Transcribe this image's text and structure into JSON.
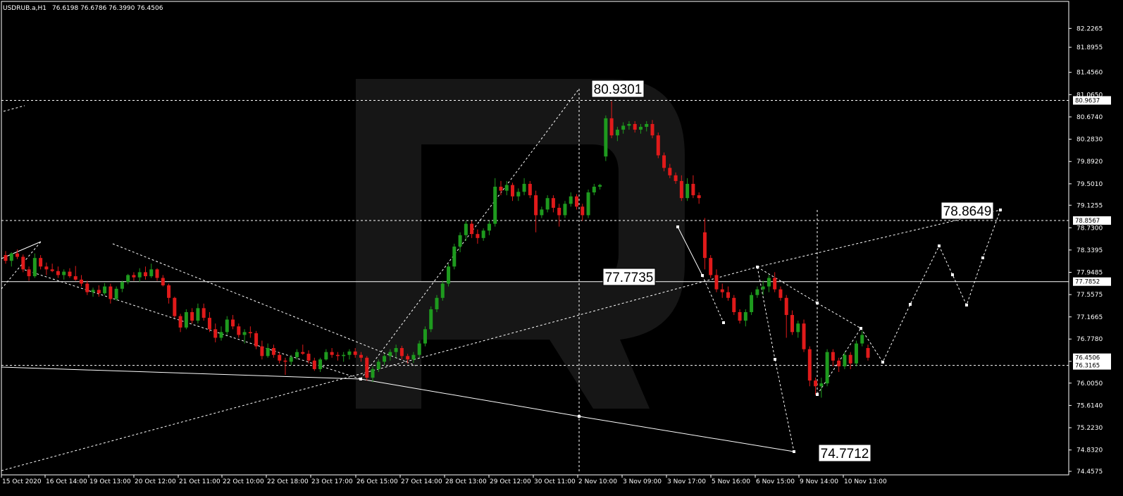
{
  "header": {
    "symbol": "USDRUB.a,H1",
    "ohlc": "76.6198 76.6786 76.3990 76.4506"
  },
  "chart_data": {
    "type": "candlestick",
    "ylim": [
      74.4575,
      82.4775
    ],
    "y_ticks": [
      "82.2265",
      "81.8955",
      "81.4560",
      "81.0650",
      "80.6740",
      "80.2830",
      "79.8920",
      "79.5010",
      "79.1255",
      "78.7300",
      "78.3395",
      "77.9485",
      "77.5575",
      "77.1665",
      "76.7780",
      "76.3870",
      "76.0050",
      "75.6140",
      "75.2230",
      "74.8320",
      "74.4575"
    ],
    "x_ticks": [
      "15 Oct 2020",
      "16 Oct 14:00",
      "19 Oct 13:00",
      "20 Oct 12:00",
      "21 Oct 11:00",
      "22 Oct 10:00",
      "22 Oct 18:00",
      "23 Oct 17:00",
      "26 Oct 15:00",
      "27 Oct 14:00",
      "28 Oct 13:00",
      "29 Oct 12:00",
      "30 Oct 11:00",
      "2 Nov 10:00",
      "3 Nov 09:00",
      "3 Nov 17:00",
      "5 Nov 16:00",
      "6 Nov 15:00",
      "9 Nov 14:00",
      "10 Nov 13:00"
    ],
    "price_tags": [
      {
        "value": 80.9637,
        "label": "80.9637"
      },
      {
        "value": 78.8567,
        "label": "78.8567"
      },
      {
        "value": 77.7852,
        "label": "77.7852"
      },
      {
        "value": 76.4506,
        "label": "76.4506"
      },
      {
        "value": 76.3165,
        "label": "76.3165"
      }
    ],
    "level_labels": [
      {
        "text": "80.9301",
        "value": 80.9301
      },
      {
        "text": "78.8649",
        "value": 78.8649
      },
      {
        "text": "77.7735",
        "value": 77.7735
      },
      {
        "text": "74.7712",
        "value": 74.7712
      }
    ],
    "candles": [
      [
        78.25,
        78.32,
        78.1,
        78.15
      ],
      [
        78.15,
        78.3,
        78.05,
        78.28
      ],
      [
        78.28,
        78.35,
        78.18,
        78.22
      ],
      [
        78.22,
        78.26,
        77.95,
        78.0
      ],
      [
        78.0,
        78.05,
        77.8,
        77.88
      ],
      [
        77.88,
        78.28,
        77.85,
        78.2
      ],
      [
        78.2,
        78.25,
        78.0,
        78.05
      ],
      [
        78.05,
        78.12,
        77.9,
        78.0
      ],
      [
        78.0,
        78.1,
        77.95,
        77.97
      ],
      [
        77.97,
        78.05,
        77.85,
        77.9
      ],
      [
        77.9,
        78.0,
        77.82,
        77.96
      ],
      [
        77.96,
        78.02,
        77.85,
        77.88
      ],
      [
        77.88,
        78.06,
        77.8,
        77.82
      ],
      [
        77.82,
        77.9,
        77.7,
        77.75
      ],
      [
        77.75,
        77.8,
        77.55,
        77.6
      ],
      [
        77.6,
        77.68,
        77.52,
        77.64
      ],
      [
        77.64,
        77.72,
        77.52,
        77.58
      ],
      [
        77.58,
        77.76,
        77.55,
        77.7
      ],
      [
        77.7,
        77.75,
        77.4,
        77.48
      ],
      [
        77.48,
        77.7,
        77.45,
        77.66
      ],
      [
        77.66,
        77.8,
        77.6,
        77.78
      ],
      [
        77.78,
        77.92,
        77.74,
        77.9
      ],
      [
        77.9,
        77.95,
        77.8,
        77.86
      ],
      [
        77.86,
        78.02,
        77.78,
        77.95
      ],
      [
        77.95,
        78.05,
        77.82,
        77.88
      ],
      [
        77.88,
        78.1,
        77.85,
        78.0
      ],
      [
        78.0,
        78.02,
        77.8,
        77.85
      ],
      [
        77.85,
        77.9,
        77.7,
        77.72
      ],
      [
        77.72,
        77.75,
        77.4,
        77.5
      ],
      [
        77.5,
        77.52,
        77.15,
        77.18
      ],
      [
        77.18,
        77.22,
        76.9,
        76.98
      ],
      [
        76.98,
        77.3,
        76.95,
        77.25
      ],
      [
        77.25,
        77.32,
        77.05,
        77.1
      ],
      [
        77.1,
        77.4,
        77.05,
        77.32
      ],
      [
        77.32,
        77.4,
        77.1,
        77.15
      ],
      [
        77.15,
        77.25,
        76.9,
        76.95
      ],
      [
        76.95,
        77.05,
        76.72,
        76.8
      ],
      [
        76.8,
        77.0,
        76.75,
        76.9
      ],
      [
        76.9,
        77.18,
        76.85,
        77.12
      ],
      [
        77.12,
        77.2,
        76.95,
        77.0
      ],
      [
        77.0,
        77.05,
        76.8,
        76.85
      ],
      [
        76.85,
        76.95,
        76.7,
        76.9
      ],
      [
        76.9,
        77.0,
        76.8,
        76.88
      ],
      [
        76.88,
        76.92,
        76.6,
        76.65
      ],
      [
        76.65,
        76.75,
        76.42,
        76.48
      ],
      [
        76.48,
        76.7,
        76.45,
        76.62
      ],
      [
        76.62,
        76.68,
        76.45,
        76.5
      ],
      [
        76.5,
        76.55,
        76.35,
        76.4
      ],
      [
        76.4,
        76.45,
        76.15,
        76.38
      ],
      [
        76.38,
        76.5,
        76.32,
        76.46
      ],
      [
        76.46,
        76.6,
        76.42,
        76.55
      ],
      [
        76.55,
        76.68,
        76.5,
        76.52
      ],
      [
        76.52,
        76.58,
        76.35,
        76.4
      ],
      [
        76.4,
        76.45,
        76.22,
        76.25
      ],
      [
        76.25,
        76.45,
        76.2,
        76.42
      ],
      [
        76.42,
        76.6,
        76.4,
        76.55
      ],
      [
        76.55,
        76.62,
        76.45,
        76.5
      ],
      [
        76.5,
        76.55,
        76.4,
        76.48
      ],
      [
        76.48,
        76.55,
        76.38,
        76.5
      ],
      [
        76.5,
        76.6,
        76.42,
        76.56
      ],
      [
        76.56,
        76.62,
        76.45,
        76.5
      ],
      [
        76.5,
        76.55,
        76.38,
        76.45
      ],
      [
        76.45,
        76.48,
        76.05,
        76.1
      ],
      [
        76.1,
        76.3,
        76.02,
        76.25
      ],
      [
        76.25,
        76.42,
        76.2,
        76.38
      ],
      [
        76.38,
        76.52,
        76.32,
        76.48
      ],
      [
        76.48,
        76.6,
        76.4,
        76.55
      ],
      [
        76.55,
        76.68,
        76.45,
        76.62
      ],
      [
        76.62,
        76.66,
        76.42,
        76.48
      ],
      [
        76.48,
        76.52,
        76.35,
        76.42
      ],
      [
        76.42,
        76.55,
        76.36,
        76.5
      ],
      [
        76.5,
        76.75,
        76.45,
        76.7
      ],
      [
        76.7,
        77.0,
        76.65,
        76.95
      ],
      [
        76.95,
        77.35,
        76.9,
        77.3
      ],
      [
        77.3,
        77.55,
        77.25,
        77.5
      ],
      [
        77.5,
        77.8,
        77.45,
        77.75
      ],
      [
        77.75,
        78.1,
        77.7,
        78.05
      ],
      [
        78.05,
        78.45,
        78.0,
        78.4
      ],
      [
        78.4,
        78.65,
        78.3,
        78.6
      ],
      [
        78.6,
        78.85,
        78.5,
        78.8
      ],
      [
        78.8,
        78.85,
        78.55,
        78.62
      ],
      [
        78.62,
        78.7,
        78.45,
        78.55
      ],
      [
        78.55,
        78.72,
        78.5,
        78.68
      ],
      [
        78.68,
        78.85,
        78.6,
        78.8
      ],
      [
        78.8,
        79.6,
        78.75,
        79.45
      ],
      [
        79.45,
        79.55,
        79.3,
        79.38
      ],
      [
        79.38,
        79.55,
        79.3,
        79.48
      ],
      [
        79.48,
        79.52,
        79.2,
        79.28
      ],
      [
        79.28,
        79.42,
        79.2,
        79.36
      ],
      [
        79.36,
        79.6,
        79.3,
        79.5
      ],
      [
        79.5,
        79.55,
        79.25,
        79.3
      ],
      [
        79.3,
        79.38,
        78.65,
        78.95
      ],
      [
        78.95,
        79.1,
        78.9,
        79.05
      ],
      [
        79.05,
        79.3,
        79.0,
        79.25
      ],
      [
        79.25,
        79.3,
        79.0,
        79.08
      ],
      [
        79.08,
        79.15,
        78.75,
        78.95
      ],
      [
        78.95,
        79.2,
        78.9,
        79.15
      ],
      [
        79.15,
        79.35,
        79.1,
        79.28
      ],
      [
        79.28,
        79.32,
        79.05,
        79.1
      ],
      [
        79.1,
        79.15,
        78.85,
        78.95
      ],
      [
        78.95,
        79.4,
        78.9,
        79.35
      ],
      [
        79.35,
        79.5,
        79.3,
        79.45
      ],
      [
        79.45,
        79.5,
        79.4,
        79.48
      ],
      [
        79.98,
        80.7,
        79.9,
        80.65
      ],
      [
        80.65,
        80.95,
        80.3,
        80.35
      ],
      [
        80.35,
        80.5,
        80.25,
        80.45
      ],
      [
        80.45,
        80.58,
        80.38,
        80.52
      ],
      [
        80.52,
        80.6,
        80.45,
        80.55
      ],
      [
        80.55,
        80.6,
        80.4,
        80.45
      ],
      [
        80.45,
        80.55,
        80.38,
        80.5
      ],
      [
        80.5,
        80.6,
        80.42,
        80.55
      ],
      [
        80.55,
        80.62,
        80.3,
        80.35
      ],
      [
        80.35,
        80.4,
        79.95,
        80.0
      ],
      [
        80.0,
        80.05,
        79.72,
        79.78
      ],
      [
        79.78,
        79.85,
        79.6,
        79.65
      ],
      [
        79.65,
        79.7,
        79.5,
        79.55
      ],
      [
        79.55,
        79.65,
        79.2,
        79.25
      ],
      [
        79.25,
        79.6,
        79.2,
        79.5
      ],
      [
        79.5,
        79.65,
        79.25,
        79.3
      ],
      [
        79.3,
        79.35,
        79.15,
        79.25
      ],
      [
        78.65,
        78.9,
        78.0,
        78.2
      ],
      [
        78.2,
        78.25,
        77.85,
        77.9
      ],
      [
        77.9,
        78.0,
        77.6,
        77.65
      ],
      [
        77.65,
        77.75,
        77.5,
        77.6
      ],
      [
        77.6,
        77.7,
        77.45,
        77.5
      ],
      [
        77.5,
        77.55,
        77.2,
        77.25
      ],
      [
        77.25,
        77.3,
        77.05,
        77.1
      ],
      [
        77.1,
        77.3,
        77.0,
        77.25
      ],
      [
        77.25,
        77.6,
        77.2,
        77.55
      ],
      [
        77.55,
        77.7,
        77.5,
        77.65
      ],
      [
        77.65,
        77.8,
        77.55,
        77.7
      ],
      [
        77.7,
        77.9,
        77.6,
        77.85
      ],
      [
        77.85,
        77.95,
        77.6,
        77.65
      ],
      [
        77.65,
        77.7,
        77.45,
        77.5
      ],
      [
        77.5,
        77.55,
        76.8,
        77.2
      ],
      [
        77.2,
        77.28,
        76.85,
        76.9
      ],
      [
        76.9,
        77.1,
        76.8,
        77.05
      ],
      [
        77.05,
        77.12,
        76.55,
        76.6
      ],
      [
        76.6,
        76.65,
        75.95,
        76.05
      ],
      [
        76.05,
        76.1,
        75.8,
        75.95
      ],
      [
        75.95,
        76.1,
        75.75,
        76.0
      ],
      [
        76.0,
        76.6,
        75.95,
        76.55
      ],
      [
        76.55,
        76.6,
        76.3,
        76.4
      ],
      [
        76.4,
        76.45,
        76.2,
        76.3
      ],
      [
        76.3,
        76.55,
        76.25,
        76.5
      ],
      [
        76.5,
        76.55,
        76.25,
        76.35
      ],
      [
        76.35,
        76.75,
        76.3,
        76.7
      ],
      [
        76.7,
        76.92,
        76.65,
        76.85
      ],
      [
        76.62,
        76.68,
        76.4,
        76.45
      ]
    ]
  }
}
